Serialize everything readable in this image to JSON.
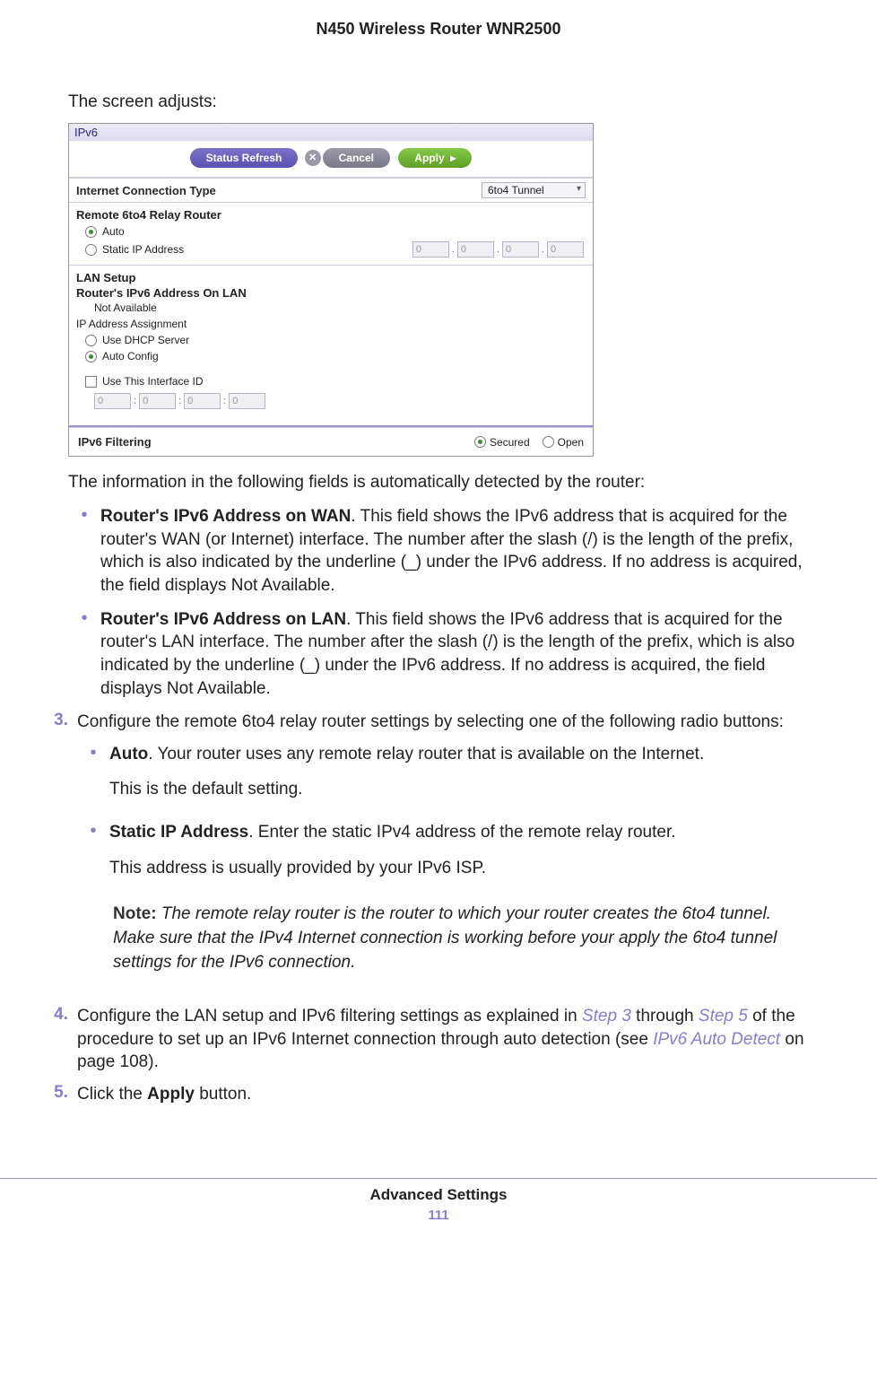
{
  "header": {
    "product": "N450 Wireless Router WNR2500"
  },
  "intro": "The screen adjusts:",
  "screenshot": {
    "title": "IPv6",
    "buttons": {
      "refresh": "Status Refresh",
      "cancel": "Cancel",
      "apply": "Apply"
    },
    "conn_type_label": "Internet Connection Type",
    "conn_type_value": "6to4 Tunnel",
    "relay_section": "Remote 6to4 Relay Router",
    "relay_auto": "Auto",
    "relay_static": "Static IP Address",
    "ip_placeholder": "0",
    "lan_section": "LAN Setup",
    "lan_router_addr": "Router's IPv6 Address On LAN",
    "lan_not_avail": "Not Available",
    "ip_assignment": "IP Address Assignment",
    "use_dhcp": "Use DHCP Server",
    "auto_config": "Auto Config",
    "use_if_id": "Use This Interface ID",
    "filter_label": "IPv6 Filtering",
    "filter_secured": "Secured",
    "filter_open": "Open"
  },
  "detect_line": "The information in the following fields is automatically detected by the router:",
  "bullet_wan_title": "Router's IPv6 Address on WAN",
  "bullet_wan_body": ". This field shows the IPv6 address that is acquired for the router's WAN (or Internet) interface. The number after the slash (/) is the length of the prefix, which is also indicated by the underline (_) under the IPv6 address. If no address is acquired, the field displays Not Available.",
  "bullet_lan_title": "Router's IPv6 Address on LAN",
  "bullet_lan_body": ". This field shows the IPv6 address that is acquired for the router's LAN interface. The number after the slash (/) is the length of the prefix, which is also indicated by the underline (_) under the IPv6 address. If no address is acquired, the field displays Not Available.",
  "step3_num": "3.",
  "step3_body": "Configure the remote 6to4 relay router settings by selecting one of the following radio buttons:",
  "auto_title": "Auto",
  "auto_body": ". Your router uses any remote relay router that is available on the Internet.",
  "auto_default": "This is the default setting.",
  "static_title": "Static IP Address",
  "static_body": ". Enter the static IPv4 address of the remote relay router.",
  "static_isp": "This address is usually provided by your IPv6 ISP.",
  "note_label": "Note:",
  "note_body": "The remote relay router is the router to which your router creates the 6to4 tunnel. Make sure that the IPv4 Internet connection is working before your apply the 6to4 tunnel settings for the IPv6 connection.",
  "step4_num": "4.",
  "step4_p1": "Configure the LAN setup and IPv6 filtering settings as explained in ",
  "step4_link1": "Step 3",
  "step4_mid1": " through ",
  "step4_link2": "Step 5",
  "step4_p2": " of the procedure to set up an IPv6 Internet connection through auto detection (see ",
  "step4_link3": "IPv6 Auto Detect",
  "step4_p3": " on page 108).",
  "step5_num": "5.",
  "step5_p1": "Click the ",
  "step5_bold": "Apply",
  "step5_p2": " button.",
  "footer": {
    "section": "Advanced Settings",
    "page": "111"
  }
}
